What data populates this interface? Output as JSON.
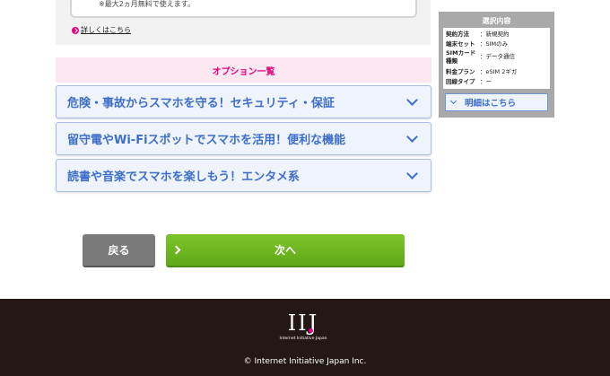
{
  "top_panel": {
    "notice": "※最大2ヵ月無料で使えます。",
    "detail_link": "詳しくはこちら"
  },
  "options": {
    "title": "オプション一覧",
    "items": [
      {
        "label": "危険・事故からスマホを守る！セキュリティ・保証"
      },
      {
        "label": "留守電やWi-Fiスポットでスマホを活用！便利な機能"
      },
      {
        "label": "読書や音楽でスマホを楽しもう！エンタメ系"
      }
    ]
  },
  "summary": {
    "title": "選択内容",
    "rows": [
      {
        "key": "契約方法",
        "value": "：新規契約"
      },
      {
        "key": "端末セット",
        "value": "：SIMのみ"
      },
      {
        "key": "SIMカード種類",
        "value": "：データ通信"
      },
      {
        "key": "料金プラン",
        "value": "：eSIM 2ギガ"
      },
      {
        "key": "回線タイプ",
        "value": "：ー"
      }
    ],
    "button_label": "明細はこちら"
  },
  "nav": {
    "back_label": "戻る",
    "next_label": "次へ"
  },
  "footer": {
    "logo_text": "IIJ",
    "logo_sub": "Internet Initiative Japan",
    "copyright": "© Internet Initiative Japan Inc."
  },
  "colors": {
    "accent_pink": "#e4007f",
    "accent_blue": "#3d6fc9",
    "next_green": "#6fb824",
    "footer_bg": "#231815"
  }
}
